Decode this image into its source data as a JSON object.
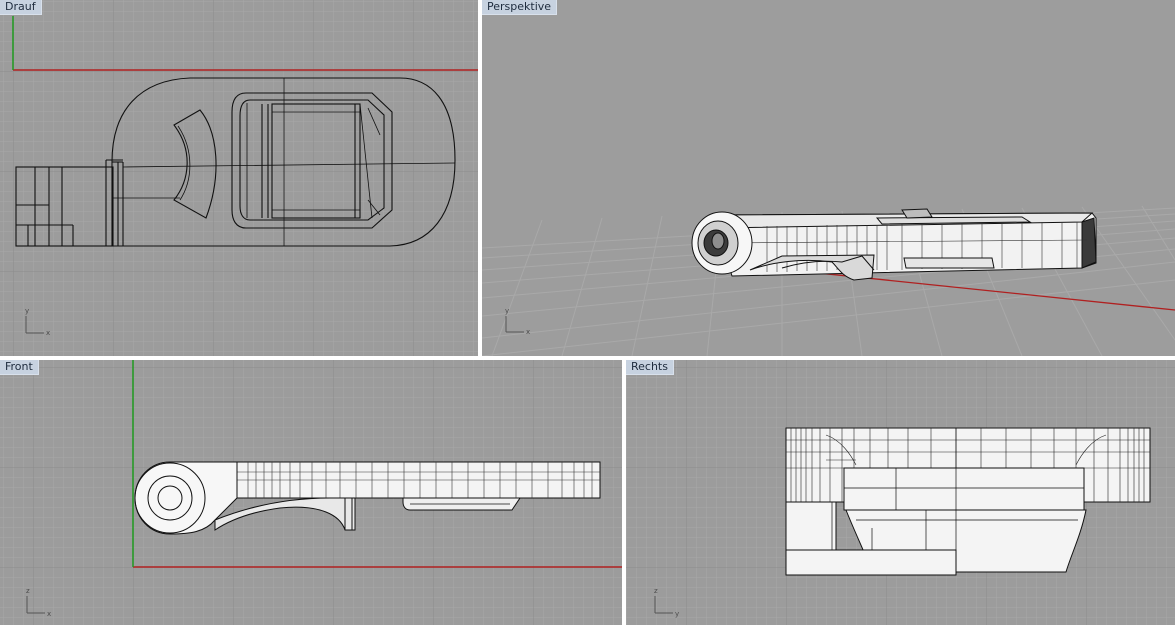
{
  "viewports": {
    "top": {
      "label": "Drauf",
      "axis_h": "x",
      "axis_v": "y"
    },
    "perspective": {
      "label": "Perspektive",
      "axis_h": "x",
      "axis_v": "y"
    },
    "front": {
      "label": "Front",
      "axis_h": "x",
      "axis_v": "z"
    },
    "right": {
      "label": "Rechts",
      "axis_h": "y",
      "axis_v": "z"
    }
  },
  "colors": {
    "viewport_background": "#9c9c9c",
    "grid_minor": "#a6a6a6",
    "grid_major": "#8e8e8e",
    "axis_x": "#b02020",
    "axis_y": "#1e9a1e",
    "object_fill": "#f4f4f4",
    "object_edge": "#111111",
    "label_background": "#c7d2e0"
  }
}
